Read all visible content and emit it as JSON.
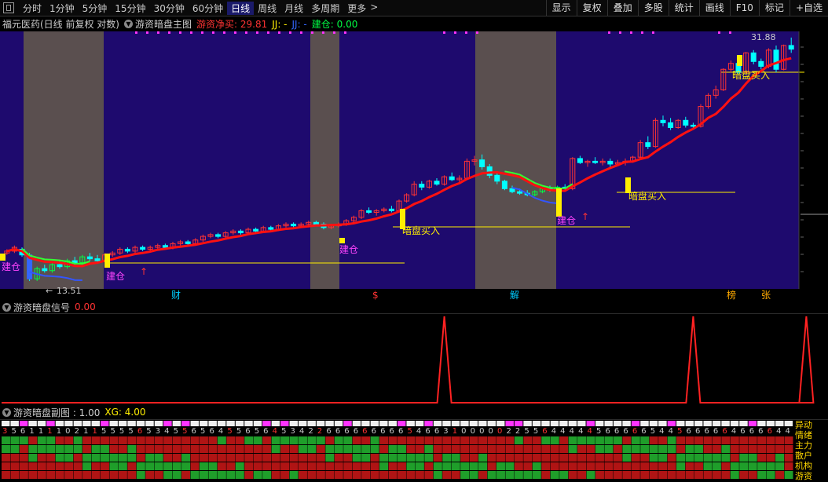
{
  "toolbar": {
    "periods": [
      {
        "label": "分时",
        "active": false
      },
      {
        "label": "1分钟",
        "active": false
      },
      {
        "label": "5分钟",
        "active": false
      },
      {
        "label": "15分钟",
        "active": false
      },
      {
        "label": "30分钟",
        "active": false
      },
      {
        "label": "60分钟",
        "active": false
      },
      {
        "label": "日线",
        "active": true
      },
      {
        "label": "周线",
        "active": false
      },
      {
        "label": "月线",
        "active": false
      },
      {
        "label": "多周期",
        "active": false
      },
      {
        "label": "更多",
        "active": false
      }
    ],
    "more_arrow": ">",
    "buttons": [
      "显示",
      "复权",
      "叠加",
      "多股",
      "统计",
      "画线",
      "F10",
      "标记",
      "+自选"
    ]
  },
  "title": {
    "stock": "福元医药(日线 前复权 对数)",
    "indicator": "游资暗盘主图",
    "buy_label": "游资净买: 29.81",
    "jj_label": "JJ: -",
    "jj2_label": "JJ: -",
    "build_label": "建仓: 0.00"
  },
  "main_chart": {
    "high_label": "31.88",
    "low_label": "13.51",
    "annotations": [
      {
        "text": "建仓",
        "color": "#ff44ff"
      },
      {
        "text": "建仓",
        "color": "#ff44ff"
      },
      {
        "text": "建仓",
        "color": "#ff44ff"
      },
      {
        "text": "建仓",
        "color": "#ff44ff"
      },
      {
        "text": "暗盘买入",
        "color": "#ffee00"
      },
      {
        "text": "暗盘买入",
        "color": "#ffee00"
      },
      {
        "text": "暗盘买入",
        "color": "#ffee00"
      }
    ],
    "event_markers": [
      {
        "text": "财",
        "color": "#00ccff"
      },
      {
        "text": "$",
        "color": "#ff3333"
      },
      {
        "text": "解",
        "color": "#00ccff"
      },
      {
        "text": "榜",
        "color": "#ffaa00"
      },
      {
        "text": "张",
        "color": "#ffaa00"
      }
    ],
    "colors": {
      "bg": "#1e0a6e",
      "shade": "#5a4f4f",
      "up": "#ff3333",
      "ma": "#ff1111"
    }
  },
  "signal_panel": {
    "title": "游资暗盘信号",
    "value": "0.00"
  },
  "sub_panel": {
    "title": "游资暗盘副图 : 1.00",
    "xg": "XG: 4.00",
    "side_labels": [
      "异动",
      "情绪",
      "主力",
      "散户",
      "机构",
      "游资"
    ],
    "digits": "3561111021155556534556564556564534226666666665466310000022556444445666665445666664666644"
  },
  "chart_data": {
    "type": "candlestick",
    "title": "福元医药(日线 前复权 对数)",
    "y_labels": [
      "31.88",
      "13.51"
    ],
    "signal_series": {
      "name": "游资暗盘信号",
      "peaks_near_candle": [
        58,
        91,
        106
      ]
    },
    "candles": [
      [
        14.9,
        15.1,
        14.8,
        15.0
      ],
      [
        15.0,
        15.3,
        14.9,
        15.2
      ],
      [
        15.1,
        15.2,
        14.7,
        14.8
      ],
      [
        14.8,
        14.9,
        13.5,
        13.6
      ],
      [
        13.6,
        14.2,
        13.5,
        14.1
      ],
      [
        14.1,
        14.3,
        13.9,
        14.0
      ],
      [
        14.0,
        14.4,
        13.9,
        14.3
      ],
      [
        14.3,
        14.5,
        14.1,
        14.2
      ],
      [
        14.2,
        14.6,
        14.1,
        14.5
      ],
      [
        14.5,
        14.7,
        14.3,
        14.4
      ],
      [
        14.4,
        14.8,
        14.3,
        14.7
      ],
      [
        14.7,
        14.9,
        14.5,
        14.6
      ],
      [
        14.6,
        14.8,
        14.4,
        14.5
      ],
      [
        14.5,
        14.9,
        14.4,
        14.8
      ],
      [
        14.8,
        15.0,
        14.7,
        14.9
      ],
      [
        14.9,
        15.2,
        14.8,
        15.1
      ],
      [
        15.1,
        15.2,
        14.9,
        15.0
      ],
      [
        15.0,
        15.3,
        14.9,
        15.2
      ],
      [
        15.2,
        15.3,
        15.0,
        15.1
      ],
      [
        15.1,
        15.3,
        15.0,
        15.2
      ],
      [
        15.2,
        15.4,
        15.1,
        15.3
      ],
      [
        15.3,
        15.4,
        15.1,
        15.2
      ],
      [
        15.2,
        15.5,
        15.1,
        15.4
      ],
      [
        15.4,
        15.6,
        15.3,
        15.5
      ],
      [
        15.5,
        15.6,
        15.3,
        15.4
      ],
      [
        15.4,
        15.7,
        15.3,
        15.6
      ],
      [
        15.6,
        15.9,
        15.5,
        15.8
      ],
      [
        15.8,
        16.0,
        15.7,
        15.9
      ],
      [
        15.9,
        16.0,
        15.7,
        15.8
      ],
      [
        15.8,
        16.1,
        15.7,
        16.0
      ],
      [
        16.0,
        16.2,
        15.9,
        16.1
      ],
      [
        16.1,
        16.2,
        15.9,
        16.0
      ],
      [
        16.0,
        16.3,
        15.9,
        16.2
      ],
      [
        16.2,
        16.3,
        16.0,
        16.1
      ],
      [
        16.1,
        16.4,
        16.0,
        16.3
      ],
      [
        16.3,
        16.4,
        16.1,
        16.2
      ],
      [
        16.2,
        16.5,
        16.1,
        16.4
      ],
      [
        16.4,
        16.6,
        16.3,
        16.5
      ],
      [
        16.5,
        16.6,
        16.3,
        16.4
      ],
      [
        16.4,
        16.6,
        16.3,
        16.5
      ],
      [
        16.5,
        16.7,
        16.4,
        16.6
      ],
      [
        16.6,
        16.7,
        16.4,
        16.5
      ],
      [
        16.5,
        16.6,
        16.2,
        16.3
      ],
      [
        16.3,
        16.5,
        16.2,
        16.4
      ],
      [
        16.4,
        16.6,
        16.3,
        16.5
      ],
      [
        16.5,
        16.8,
        16.4,
        16.7
      ],
      [
        16.7,
        17.0,
        16.6,
        16.9
      ],
      [
        16.9,
        17.4,
        16.8,
        17.3
      ],
      [
        17.3,
        17.5,
        17.1,
        17.2
      ],
      [
        17.2,
        17.4,
        17.0,
        17.3
      ],
      [
        17.3,
        17.5,
        17.2,
        17.4
      ],
      [
        17.4,
        17.6,
        17.2,
        17.3
      ],
      [
        17.3,
        18.0,
        17.2,
        17.9
      ],
      [
        17.9,
        18.4,
        17.8,
        18.3
      ],
      [
        18.3,
        19.2,
        18.2,
        19.0
      ],
      [
        19.0,
        19.2,
        18.6,
        18.8
      ],
      [
        18.8,
        19.3,
        18.7,
        19.2
      ],
      [
        19.2,
        19.4,
        18.9,
        19.0
      ],
      [
        19.0,
        19.6,
        18.9,
        19.5
      ],
      [
        19.5,
        19.8,
        19.2,
        19.3
      ],
      [
        19.3,
        19.6,
        19.1,
        19.4
      ],
      [
        19.4,
        20.8,
        19.3,
        20.6
      ],
      [
        20.6,
        21.0,
        20.3,
        20.7
      ],
      [
        20.7,
        21.1,
        20.0,
        20.2
      ],
      [
        20.2,
        20.4,
        19.4,
        19.6
      ],
      [
        19.6,
        19.8,
        19.0,
        19.2
      ],
      [
        19.2,
        19.3,
        18.6,
        18.7
      ],
      [
        18.7,
        18.9,
        18.4,
        18.5
      ],
      [
        18.5,
        18.7,
        18.3,
        18.4
      ],
      [
        18.4,
        18.6,
        18.2,
        18.3
      ],
      [
        18.3,
        18.6,
        18.2,
        18.5
      ],
      [
        18.5,
        18.8,
        18.4,
        18.7
      ],
      [
        18.7,
        18.9,
        18.5,
        18.6
      ],
      [
        18.6,
        18.9,
        18.5,
        18.8
      ],
      [
        18.8,
        19.0,
        18.6,
        18.7
      ],
      [
        18.7,
        20.9,
        18.6,
        20.8
      ],
      [
        20.8,
        21.0,
        20.4,
        20.5
      ],
      [
        20.5,
        20.7,
        20.2,
        20.6
      ],
      [
        20.6,
        20.9,
        20.4,
        20.5
      ],
      [
        20.5,
        20.8,
        20.3,
        20.6
      ],
      [
        20.6,
        20.8,
        20.2,
        20.4
      ],
      [
        20.4,
        20.7,
        20.3,
        20.5
      ],
      [
        20.5,
        20.8,
        20.3,
        20.6
      ],
      [
        20.6,
        21.0,
        20.5,
        20.9
      ],
      [
        20.9,
        22.2,
        20.8,
        22.0
      ],
      [
        22.0,
        22.5,
        21.5,
        21.7
      ],
      [
        21.7,
        24.0,
        21.6,
        23.8
      ],
      [
        23.8,
        24.2,
        23.3,
        23.6
      ],
      [
        23.6,
        24.0,
        23.0,
        23.2
      ],
      [
        23.2,
        23.9,
        23.1,
        23.8
      ],
      [
        23.8,
        24.1,
        23.2,
        23.4
      ],
      [
        23.4,
        23.6,
        23.1,
        23.3
      ],
      [
        23.3,
        25.2,
        23.2,
        25.0
      ],
      [
        25.0,
        26.2,
        24.8,
        26.0
      ],
      [
        26.0,
        26.9,
        25.7,
        26.5
      ],
      [
        26.5,
        28.6,
        26.4,
        28.5
      ],
      [
        28.5,
        29.4,
        28.2,
        29.1
      ],
      [
        29.1,
        29.4,
        28.0,
        28.2
      ],
      [
        28.2,
        30.3,
        28.1,
        30.2
      ],
      [
        30.2,
        30.5,
        29.0,
        29.3
      ],
      [
        29.3,
        29.6,
        28.5,
        28.8
      ],
      [
        28.8,
        30.7,
        28.6,
        30.5
      ],
      [
        30.5,
        31.0,
        28.2,
        28.5
      ],
      [
        28.5,
        31.1,
        28.4,
        31.0
      ],
      [
        31.0,
        31.88,
        30.2,
        30.6
      ]
    ]
  }
}
